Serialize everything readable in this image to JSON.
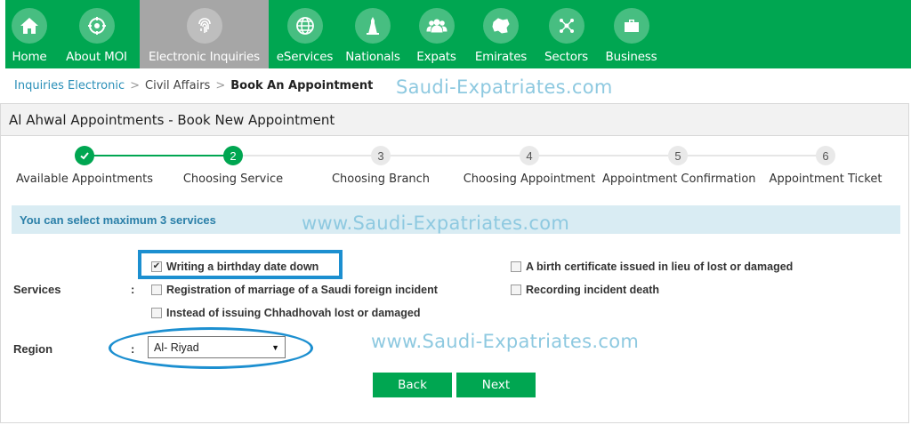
{
  "nav": {
    "items": [
      {
        "label": "Home",
        "icon": "home-icon"
      },
      {
        "label": "About MOI",
        "icon": "emblem-icon"
      },
      {
        "label": "Electronic Inquiries",
        "icon": "fingerprint-icon",
        "active": true
      },
      {
        "label": "eServices",
        "icon": "globe-icon"
      },
      {
        "label": "Nationals",
        "icon": "tower-icon"
      },
      {
        "label": "Expats",
        "icon": "people-icon"
      },
      {
        "label": "Emirates",
        "icon": "map-icon"
      },
      {
        "label": "Sectors",
        "icon": "network-icon"
      },
      {
        "label": "Business",
        "icon": "briefcase-icon"
      }
    ]
  },
  "breadcrumb": {
    "link": "Inquiries Electronic",
    "middle": "Civil Affairs",
    "current": "Book An Appointment"
  },
  "watermarks": [
    "Saudi-Expatriates.com",
    "www.Saudi-Expatriates.com",
    "www.Saudi-Expatriates.com"
  ],
  "panel": {
    "title": "Al Ahwal Appointments - Book New Appointment"
  },
  "steps": [
    {
      "number": "",
      "label": "Available Appointments",
      "state": "done"
    },
    {
      "number": "2",
      "label": "Choosing Service",
      "state": "current"
    },
    {
      "number": "3",
      "label": "Choosing Branch",
      "state": "todo"
    },
    {
      "number": "4",
      "label": "Choosing Appointment",
      "state": "todo"
    },
    {
      "number": "5",
      "label": "Appointment Confirmation",
      "state": "todo"
    },
    {
      "number": "6",
      "label": "Appointment Ticket",
      "state": "todo"
    }
  ],
  "info": "You can select maximum 3 services",
  "form": {
    "services_label": "Services",
    "region_label": "Region",
    "colon": ":",
    "services": [
      {
        "label": "Writing a birthday date down",
        "checked": true
      },
      {
        "label": "Registration of marriage of a Saudi foreign incident",
        "checked": false
      },
      {
        "label": "Instead of issuing Chhadhovah lost or damaged",
        "checked": false
      },
      {
        "label": "A birth certificate issued in lieu of lost or damaged",
        "checked": false
      },
      {
        "label": "Recording incident death",
        "checked": false
      }
    ],
    "region_value": "Al- Riyad"
  },
  "buttons": {
    "back": "Back",
    "next": "Next"
  },
  "colors": {
    "brand_green": "#00a651",
    "nav_active": "#a6a6a6",
    "highlight_blue": "#1c8fd0",
    "info_bg": "#d9ecf3"
  }
}
